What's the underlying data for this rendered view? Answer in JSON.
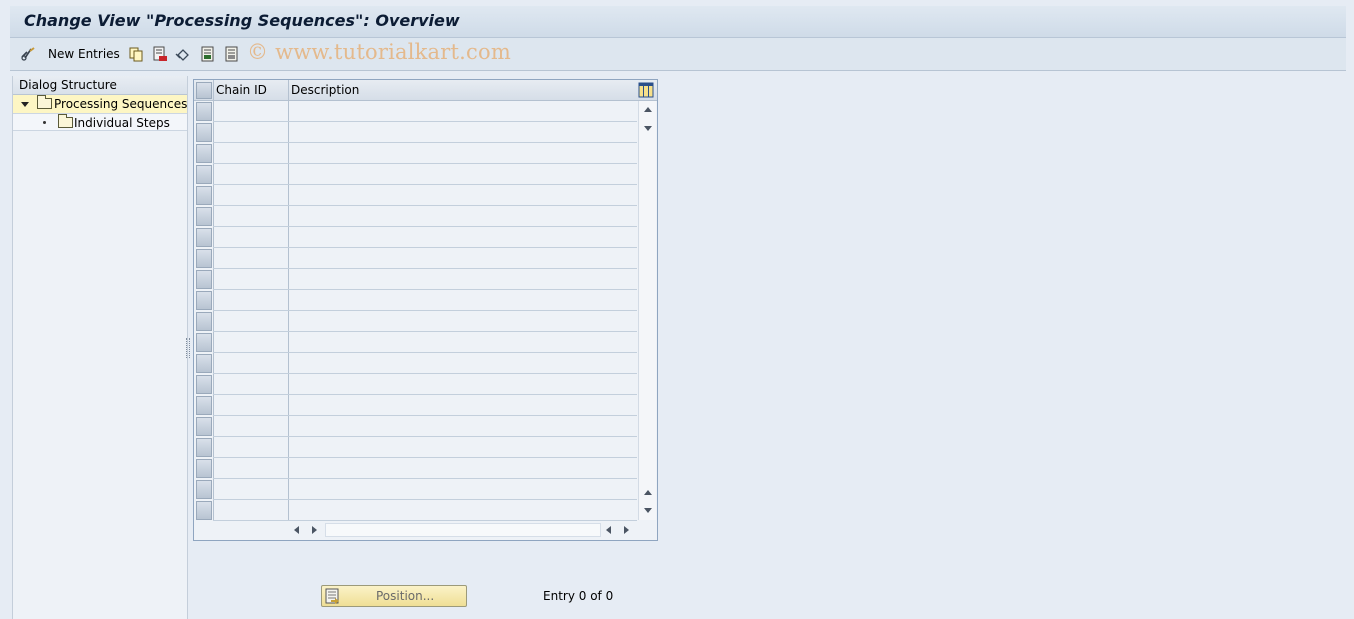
{
  "window": {
    "title": "Change View \"Processing Sequences\": Overview"
  },
  "toolbar": {
    "new_entries_label": "New Entries",
    "icons": [
      "glasses-change-icon",
      "copy-icon",
      "delete-icon",
      "undo-icon",
      "select-all-icon",
      "deselect-all-icon"
    ],
    "watermark": "© www.tutorialkart.com"
  },
  "dialog_structure": {
    "header": "Dialog Structure",
    "items": [
      {
        "label": "Processing Sequences",
        "selected": true,
        "expanded": true
      },
      {
        "label": "Individual Steps",
        "selected": false
      }
    ]
  },
  "table": {
    "columns": [
      "Chain ID",
      "Description"
    ],
    "rows": []
  },
  "footer": {
    "position_button": "Position...",
    "entry_text": "Entry 0 of 0"
  },
  "colors": {
    "selected_bg": "#fdf6c4",
    "title_text": "#0c1c34",
    "watermark": "#e4b98c"
  }
}
